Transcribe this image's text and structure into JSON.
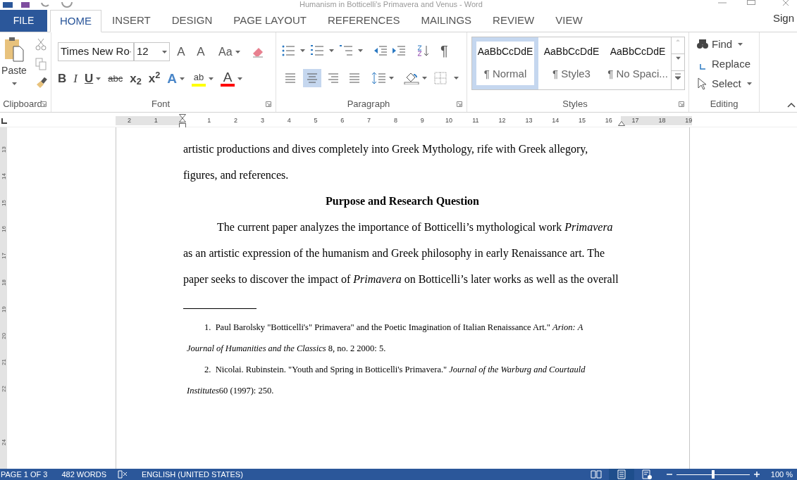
{
  "window": {
    "title": "Humanism in Botticelli's Primavera and Venus - Word"
  },
  "tabs": [
    {
      "label": "FILE",
      "kind": "file",
      "selected": false
    },
    {
      "label": "HOME",
      "kind": "tab",
      "selected": true
    },
    {
      "label": "INSERT",
      "kind": "tab",
      "selected": false
    },
    {
      "label": "DESIGN",
      "kind": "tab",
      "selected": false
    },
    {
      "label": "PAGE LAYOUT",
      "kind": "tab",
      "selected": false
    },
    {
      "label": "REFERENCES",
      "kind": "tab",
      "selected": false
    },
    {
      "label": "MAILINGS",
      "kind": "tab",
      "selected": false
    },
    {
      "label": "REVIEW",
      "kind": "tab",
      "selected": false
    },
    {
      "label": "VIEW",
      "kind": "tab",
      "selected": false
    }
  ],
  "account": "Sign",
  "ribbon": {
    "clipboard": {
      "paste": "Paste",
      "label": "Clipboard"
    },
    "font": {
      "font_name": "Times New Ro",
      "font_size": "12",
      "label": "Font",
      "row1": [
        {
          "kind": "grow",
          "label": "A"
        },
        {
          "kind": "shrink",
          "label": "A"
        },
        {
          "kind": "case",
          "label": "Aa"
        },
        {
          "kind": "clear"
        }
      ],
      "row2": [
        {
          "kind": "bold",
          "label": "B"
        },
        {
          "kind": "italic",
          "label": "I"
        },
        {
          "kind": "underline",
          "label": "U"
        },
        {
          "kind": "strike",
          "label": "abc"
        },
        {
          "kind": "sub",
          "label": "x$_{2}$"
        },
        {
          "kind": "sup",
          "label": "x$^{2}$"
        },
        {
          "kind": "effects",
          "label": "A"
        },
        {
          "kind": "highlight",
          "label": "ab",
          "color": "#ffff00"
        },
        {
          "kind": "fontcolor",
          "label": "A",
          "color": "#ff0000"
        }
      ]
    },
    "paragraph": {
      "label": "Paragraph",
      "pilcrow": "¶",
      "alignments": [
        {
          "kind": "left",
          "selected": false
        },
        {
          "kind": "center",
          "selected": true
        },
        {
          "kind": "right",
          "selected": false
        },
        {
          "kind": "justify",
          "selected": false
        }
      ]
    },
    "styles": {
      "label": "Styles",
      "items": [
        {
          "preview": "AaBbCcDdE",
          "name": "¶ Normal",
          "selected": true
        },
        {
          "preview": "AaBbCcDdE",
          "name": "¶ Style3",
          "selected": false
        },
        {
          "preview": "AaBbCcDdE",
          "name": "¶ No Spaci...",
          "selected": false
        }
      ]
    },
    "editing": {
      "label": "Editing",
      "items": [
        {
          "kind": "find",
          "label": "Find"
        },
        {
          "kind": "replace",
          "label": "Replace"
        },
        {
          "kind": "select",
          "label": "Select"
        }
      ]
    }
  },
  "ruler": {
    "labels": [
      "2",
      "1",
      "1",
      "2",
      "3",
      "4",
      "5",
      "6",
      "7",
      "8",
      "9",
      "10",
      "11",
      "12",
      "13",
      "14",
      "15",
      "16",
      "17",
      "18",
      "19"
    ]
  },
  "vertical_ruler": {
    "labels": [
      "13",
      "14",
      "15",
      "16",
      "17",
      "18",
      "19",
      "20",
      "21",
      "22",
      "24"
    ]
  },
  "document": {
    "paragraphs": [
      {
        "kind": "body",
        "indent": false,
        "text": "artistic productions and dives completely into Greek Mythology, rife with Greek allegory, figures, and references."
      },
      {
        "kind": "heading",
        "indent": false,
        "text": "Purpose and Research Question"
      },
      {
        "kind": "body",
        "indent": true,
        "text": "The current paper analyzes the importance of Botticelli’s mythological work *Primavera* as an artistic expression of the humanism and Greek philosophy in early Renaissance art. The paper seeks to discover the impact of *Primavera* on Botticelli’s later works as well as the overall"
      }
    ],
    "footnotes": [
      {
        "number": "1.",
        "parts": [
          {
            "text": "Paul Barolsky \"Botticelli's\" Primavera\" and the Poetic Imagination of Italian Renaissance Art.\" ",
            "italic": false
          },
          {
            "text": "Arion: A Journal of Humanities and the Classics",
            "italic": true
          },
          {
            "text": " 8, no. 2 2000: 5.",
            "italic": false
          }
        ]
      },
      {
        "number": "2.",
        "parts": [
          {
            "text": "Nicolai. Rubinstein. \"Youth and Spring in Botticelli's Primavera.\" ",
            "italic": false
          },
          {
            "text": "Journal of the Warburg and Courtauld Institutes",
            "italic": true
          },
          {
            "text": "60 (1997): 250.",
            "italic": false
          }
        ]
      }
    ]
  },
  "status_bar": {
    "page": "PAGE 1 OF 3",
    "words": "482 WORDS",
    "language": "ENGLISH (UNITED STATES)",
    "views": [
      {
        "kind": "read",
        "selected": false
      },
      {
        "kind": "print",
        "selected": true
      },
      {
        "kind": "web",
        "selected": false
      }
    ],
    "zoom_slider": {
      "level": 0.5
    },
    "zoom": "100 %"
  }
}
